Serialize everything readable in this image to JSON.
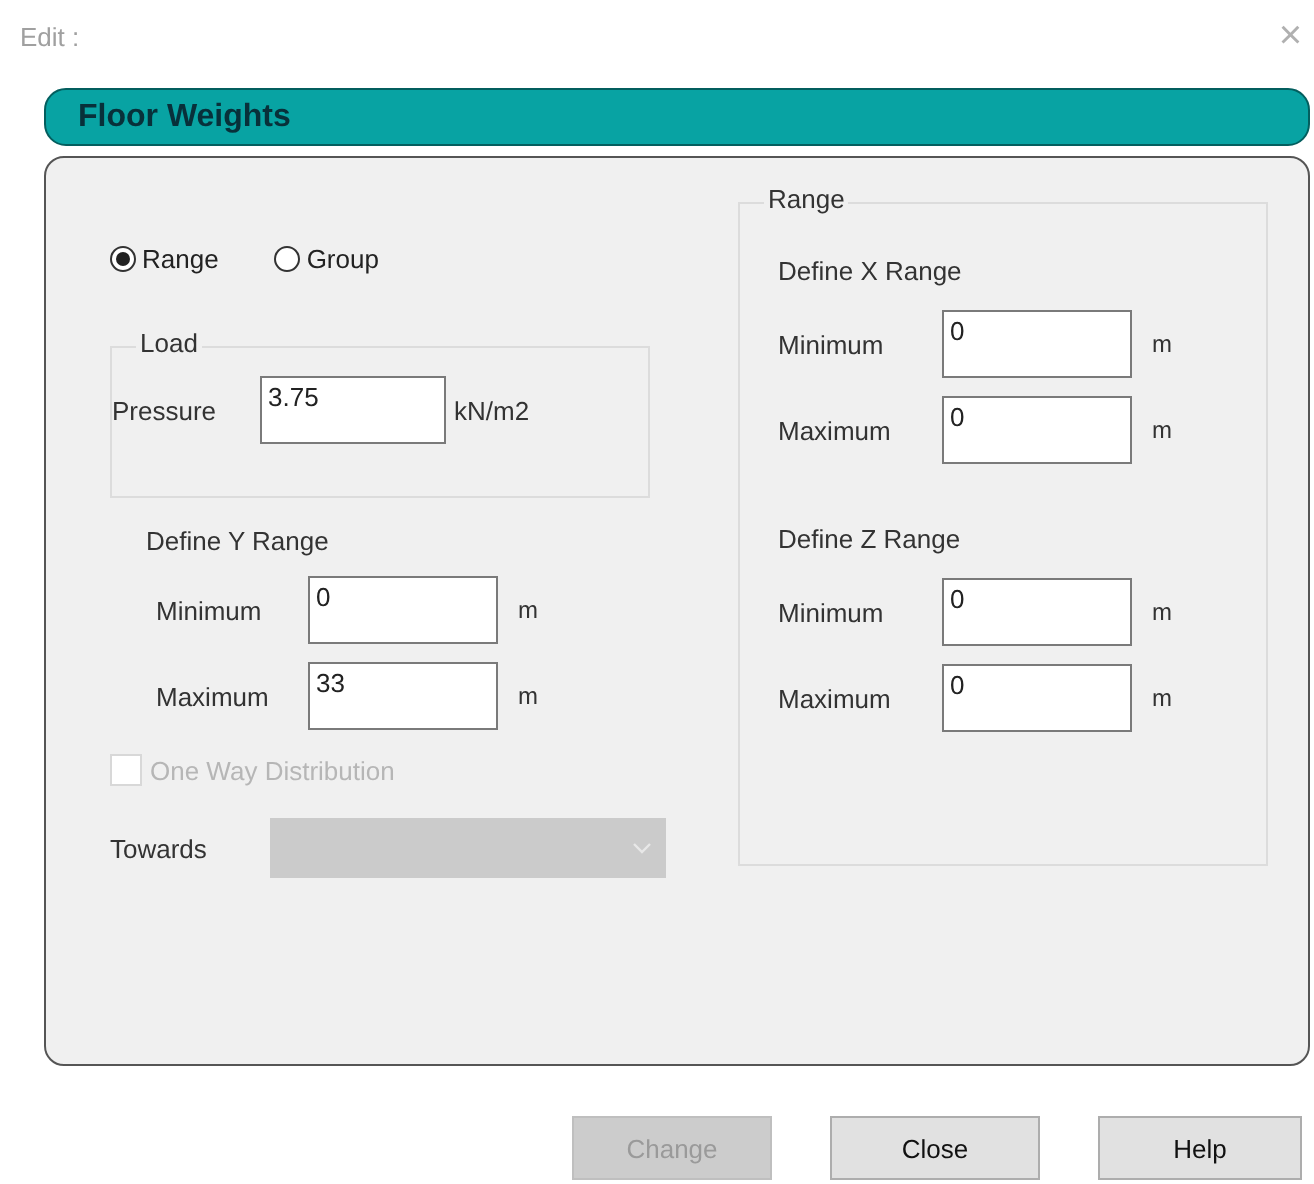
{
  "window": {
    "title": "Edit :",
    "close": "×"
  },
  "header": "Floor Weights",
  "mode": [
    {
      "label": "Range",
      "selected": true
    },
    {
      "label": "Group",
      "selected": false
    }
  ],
  "load": {
    "legend": "Load",
    "label": "Pressure",
    "value": "3.75",
    "unit": "kN/m2"
  },
  "y_range": {
    "title": "Define Y Range",
    "fields": [
      {
        "label": "Minimum",
        "value": "0",
        "unit": "m"
      },
      {
        "label": "Maximum",
        "value": "33",
        "unit": "m"
      }
    ]
  },
  "one_way": {
    "label": "One Way Distribution",
    "checked": false,
    "disabled": true
  },
  "towards": {
    "label": "Towards",
    "disabled": true
  },
  "range_group": {
    "legend": "Range",
    "sections": [
      {
        "title": "Define X Range",
        "fields": [
          {
            "label": "Minimum",
            "value": "0",
            "unit": "m"
          },
          {
            "label": "Maximum",
            "value": "0",
            "unit": "m"
          }
        ]
      },
      {
        "title": "Define Z Range",
        "fields": [
          {
            "label": "Minimum",
            "value": "0",
            "unit": "m"
          },
          {
            "label": "Maximum",
            "value": "0",
            "unit": "m"
          }
        ]
      }
    ]
  },
  "buttons": [
    {
      "label": "Change",
      "disabled": true
    },
    {
      "label": "Close",
      "disabled": false
    },
    {
      "label": "Help",
      "disabled": false
    }
  ]
}
